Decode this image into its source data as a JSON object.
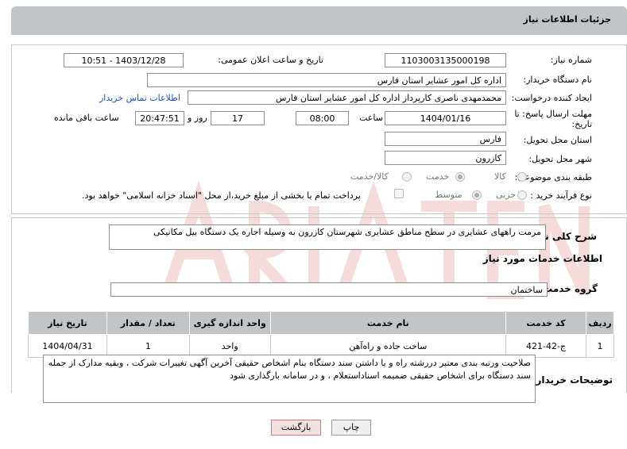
{
  "header": {
    "title": "جزئیات اطلاعات نیاز"
  },
  "need_number": {
    "label": "شماره نیاز:",
    "value": "1103003135000198"
  },
  "announce_datetime": {
    "label": "تاریخ و ساعت اعلان عمومی:",
    "value": "1403/12/28 - 10:51"
  },
  "buyer_org": {
    "label": "نام دستگاه خریدار:",
    "value": "اداره کل امور عشایر استان فارس"
  },
  "requester": {
    "label": "ایجاد کننده درخواست:",
    "value": "محمدمهدی ناصری کارپرداز اداره کل امور عشایر استان فارس",
    "contact_link": "اطلاعات تماس خریدار"
  },
  "deadline": {
    "label_line1": "مهلت ارسال پاسخ: تا",
    "label_line2": "تاریخ:",
    "date": "1404/01/16",
    "time_label": "ساعت",
    "time": "08:00",
    "days": "17",
    "days_label": "روز و",
    "remaining": "20:47:51",
    "remaining_label": "ساعت باقی مانده"
  },
  "delivery_province": {
    "label": "استان محل تحویل:",
    "value": "فارس"
  },
  "delivery_city": {
    "label": "شهر محل تحویل:",
    "value": "کازرون"
  },
  "category": {
    "label": "طبقه بندی موضوعی:",
    "options": [
      "کالا",
      "خدمت",
      "کالا/خدمت"
    ],
    "selected": "خدمت"
  },
  "process": {
    "label": "نوع فرآیند خرید :",
    "options": [
      "جزیی",
      "متوسط"
    ],
    "selected": "متوسط",
    "payment_note": "پرداخت تمام یا بخشی از مبلغ خرید،از محل \"اسناد خزانه اسلامی\" خواهد بود."
  },
  "summary": {
    "label": "شرح کلی نیاز:",
    "value": "مرمت راههای عشایری در سطح مناطق عشایری شهرستان کازرون به وسیله اجاره یک دستگاه بیل مکانیکی"
  },
  "services_section": {
    "title": "اطلاعات خدمات مورد نیاز"
  },
  "service_group": {
    "label": "گروه خدمت:",
    "value": "ساختمان"
  },
  "table": {
    "headers": [
      "ردیف",
      "کد خدمت",
      "نام خدمت",
      "واحد اندازه گیری",
      "تعداد / مقدار",
      "تاریخ نیاز"
    ],
    "rows": [
      [
        "1",
        "ج-42-421",
        "ساخت جاده و راه‌آهن",
        "واحد",
        "1",
        "1404/04/31"
      ]
    ]
  },
  "buyer_notes": {
    "label": "توضیحات خریدار:",
    "value": "صلاحیت ورتبه بندی معتبر دررشته راه و یا داشتن سند دستگاه  بنام اشخاص حقیقی  آخرین آگهی تغییرات شرکت ، وبقیه مدارک  از جمله سند دستگاه برای اشخاص حقیقی ضمیمه اسناداستعلام ، و در سامانه بارگذاری شود"
  },
  "buttons": {
    "print": "چاپ",
    "back": "بازگشت"
  },
  "colors": {
    "header_bg": "#c2c5c7",
    "link": "#1a4fd6",
    "back_border": "#e57373"
  }
}
